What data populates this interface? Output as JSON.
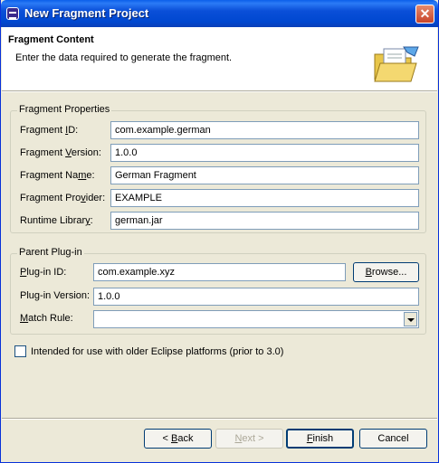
{
  "window": {
    "title": "New Fragment Project",
    "close_glyph": "✕"
  },
  "header": {
    "title": "Fragment Content",
    "description": "Enter the data required to generate the fragment."
  },
  "fragment_properties": {
    "group_title": "Fragment Properties",
    "id": {
      "label_pre": "Fragment ",
      "label_u": "I",
      "label_post": "D:",
      "value": "com.example.german"
    },
    "version": {
      "label_pre": "Fragment ",
      "label_u": "V",
      "label_post": "ersion:",
      "value": "1.0.0"
    },
    "name": {
      "label_pre": "Fragment Na",
      "label_u": "m",
      "label_post": "e:",
      "value": "German Fragment"
    },
    "provider": {
      "label_pre": "Fragment Pro",
      "label_u": "v",
      "label_post": "ider:",
      "value": "EXAMPLE"
    },
    "library": {
      "label_pre": "Runtime Librar",
      "label_u": "y",
      "label_post": ":",
      "value": "german.jar"
    }
  },
  "parent_plugin": {
    "group_title": "Parent Plug-in",
    "id": {
      "label_pre": "",
      "label_u": "P",
      "label_post": "lug-in ID:",
      "value": "com.example.xyz"
    },
    "browse": {
      "label_pre": "",
      "label_u": "B",
      "label_post": "rowse..."
    },
    "version": {
      "label_pre": "Plu",
      "label_u": "g",
      "label_post": "-in Version:",
      "value": "1.0.0"
    },
    "match_rule": {
      "label_pre": "",
      "label_u": "M",
      "label_post": "atch Rule:",
      "value": ""
    }
  },
  "legacy": {
    "label": "Intended for use with older Eclipse platforms (prior to 3.0)",
    "checked": false
  },
  "buttons": {
    "back": {
      "label_pre": "< ",
      "label_u": "B",
      "label_post": "ack"
    },
    "next": {
      "label_pre": "",
      "label_u": "N",
      "label_post": "ext >"
    },
    "finish": {
      "label_pre": "",
      "label_u": "F",
      "label_post": "inish"
    },
    "cancel": {
      "label": "Cancel"
    }
  },
  "icons": {
    "header": "folder-icon",
    "title": "eclipse-icon"
  },
  "colors": {
    "titlebar": "#0A4FD8",
    "dialog_bg": "#ECE9D8",
    "field_border": "#7F9DB9",
    "close": "#C8442A"
  }
}
